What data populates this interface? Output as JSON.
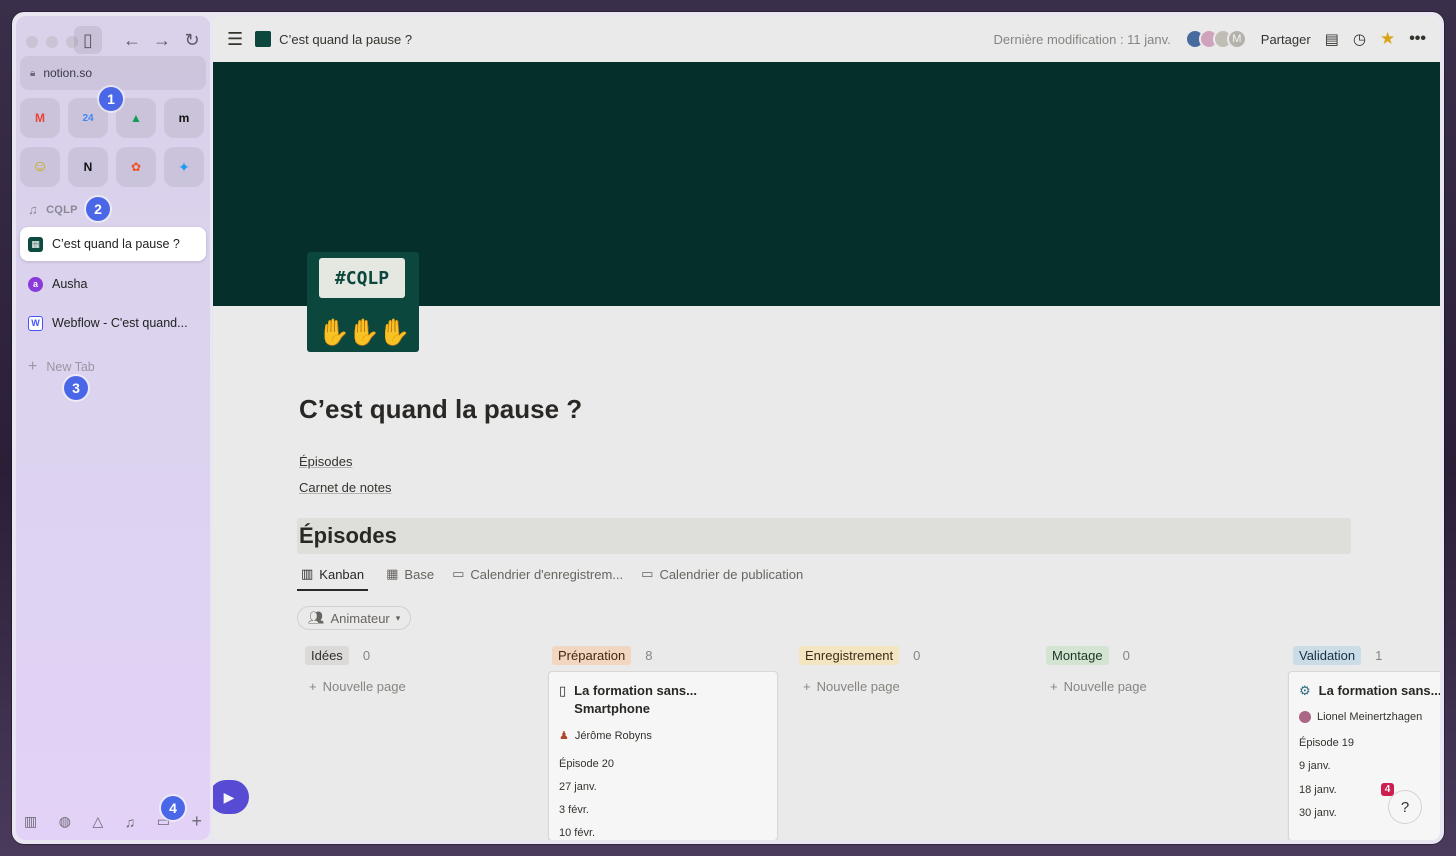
{
  "browser": {
    "url": "notion.so",
    "favorites": [
      {
        "name": "gmail-icon",
        "glyph": "M",
        "color": "#ea4335"
      },
      {
        "name": "calendar-icon",
        "glyph": "24",
        "color": "#4285f4"
      },
      {
        "name": "drive-icon",
        "glyph": "▲",
        "color": "#0f9d58"
      },
      {
        "name": "miro-icon",
        "glyph": "m",
        "color": "#f7d32c"
      },
      {
        "name": "smiley-icon",
        "glyph": "☺",
        "color": "#e8c60a"
      },
      {
        "name": "notion-icon",
        "glyph": "N",
        "color": "#111111"
      },
      {
        "name": "figma-icon",
        "glyph": "✿",
        "color": "#f24e1e"
      },
      {
        "name": "twitter-icon",
        "glyph": "✦",
        "color": "#1d9bf0"
      }
    ],
    "folder": "CQLP",
    "tabs": [
      {
        "label": "C’est quand la pause ?",
        "icon_color": "#0d4a40"
      },
      {
        "label": "Ausha",
        "icon_color": "#8a3ad8"
      },
      {
        "label": "Webflow - C'est quand...",
        "icon_color": "#4353ff"
      }
    ],
    "new_tab": "New Tab",
    "badges": [
      "1",
      "2",
      "3",
      "4"
    ]
  },
  "topbar": {
    "title": "C’est quand la pause ?",
    "last_modified": "Dernière modification : 11 janv.",
    "avatar_initial": "M",
    "share": "Partager"
  },
  "page": {
    "cover_color": "#05312c",
    "icon_text": "#CQLP",
    "title": "C’est quand la pause ?",
    "links": [
      "Épisodes",
      "Carnet de notes"
    ],
    "section": "Épisodes",
    "views": [
      "Kanban",
      "Base",
      "Calendrier d'enregistrem...",
      "Calendrier de publication"
    ],
    "filter": "Animateur",
    "new_page": "Nouvelle page",
    "columns": [
      {
        "name": "Idées",
        "count": "0",
        "bg": "#e3e2e0",
        "fg": "#32302c"
      },
      {
        "name": "Préparation",
        "count": "8",
        "bg": "#fadec9",
        "fg": "#49290e"
      },
      {
        "name": "Enregistrement",
        "count": "0",
        "bg": "#fbeec8",
        "fg": "#402c1b"
      },
      {
        "name": "Montage",
        "count": "0",
        "bg": "#dbeddb",
        "fg": "#1c3829"
      },
      {
        "name": "Validation",
        "count": "1",
        "bg": "#d3e5ef",
        "fg": "#183347"
      }
    ],
    "card1": {
      "title_line1": "La formation sans...",
      "title_line2": "Smartphone",
      "person": "Jérôme Robyns",
      "episode": "Épisode 20",
      "date1": "27 janv.",
      "date2": "3 févr.",
      "date3": "10 févr."
    },
    "card2": {
      "title": "La formation sans...",
      "person": "Lionel Meinertzhagen",
      "episode": "Épisode 19",
      "date1": "9 janv.",
      "date2": "18 janv.",
      "tag": "4",
      "date3": "30 janv."
    },
    "help": "?"
  }
}
